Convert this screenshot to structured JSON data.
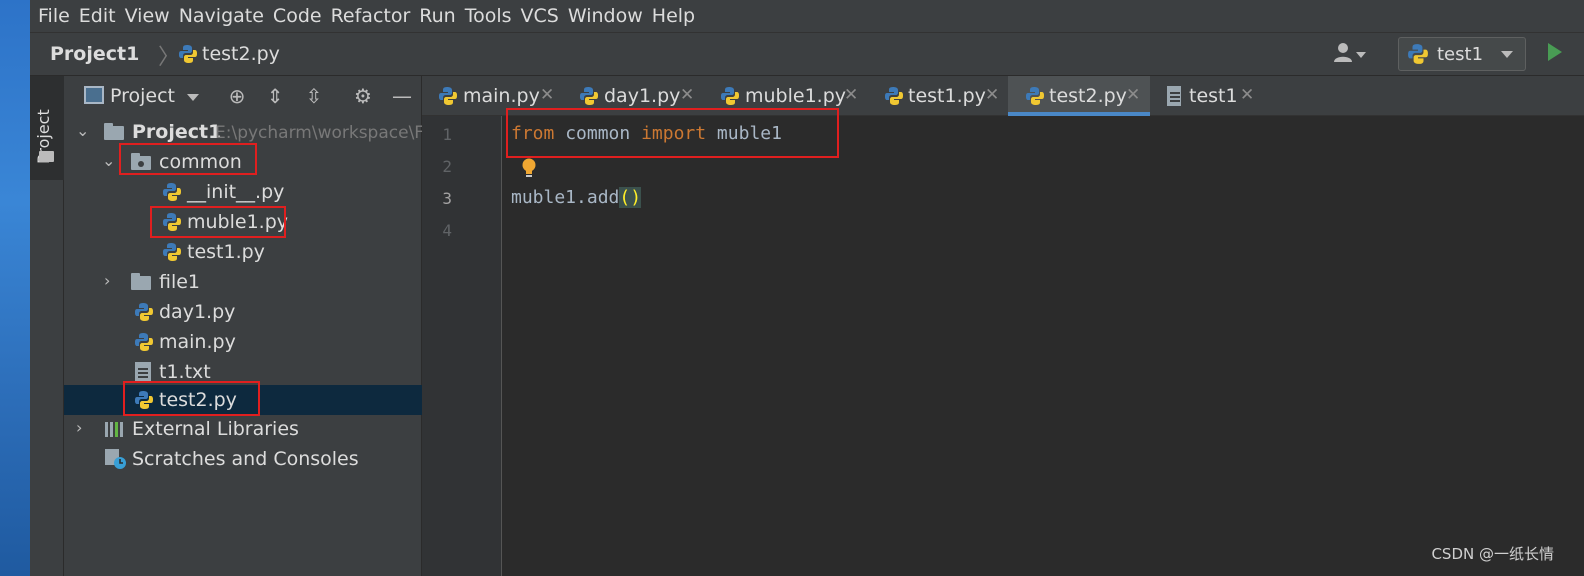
{
  "menubar": {
    "items": [
      "File",
      "Edit",
      "View",
      "Navigate",
      "Code",
      "Refactor",
      "Run",
      "Tools",
      "VCS",
      "Window",
      "Help"
    ]
  },
  "navbar": {
    "project": "Project1",
    "file": "test2.py",
    "run_config": "test1"
  },
  "toolstrip": {
    "project_tab": "Project"
  },
  "project_panel": {
    "title": "Project",
    "tree": [
      {
        "label": "Project1",
        "path": "E:\\pycharm\\workspace\\F"
      },
      {
        "label": "common"
      },
      {
        "label": "__init__.py"
      },
      {
        "label": "muble1.py"
      },
      {
        "label": "test1.py"
      },
      {
        "label": "file1"
      },
      {
        "label": "day1.py"
      },
      {
        "label": "main.py"
      },
      {
        "label": "t1.txt"
      },
      {
        "label": "test2.py"
      },
      {
        "label": "External Libraries"
      },
      {
        "label": "Scratches and Consoles"
      }
    ]
  },
  "editor_tabs": [
    {
      "name": "main.py"
    },
    {
      "name": "day1.py"
    },
    {
      "name": "muble1.py"
    },
    {
      "name": "test1.py"
    },
    {
      "name": "test2.py",
      "active": true
    },
    {
      "name": "test1"
    }
  ],
  "editor": {
    "line_numbers": [
      "1",
      "2",
      "3",
      "4"
    ],
    "line1": {
      "kw1": "from",
      "mod": " common ",
      "kw2": "import",
      "name": " muble1"
    },
    "line3": {
      "text": "muble1.add",
      "paren": "()"
    }
  },
  "colors": {
    "accent": "#4a88c7",
    "highlight_box": "#e01f1f",
    "keyword": "#cc7832",
    "run_green": "#499c54"
  },
  "watermark": "CSDN @一纸长情"
}
